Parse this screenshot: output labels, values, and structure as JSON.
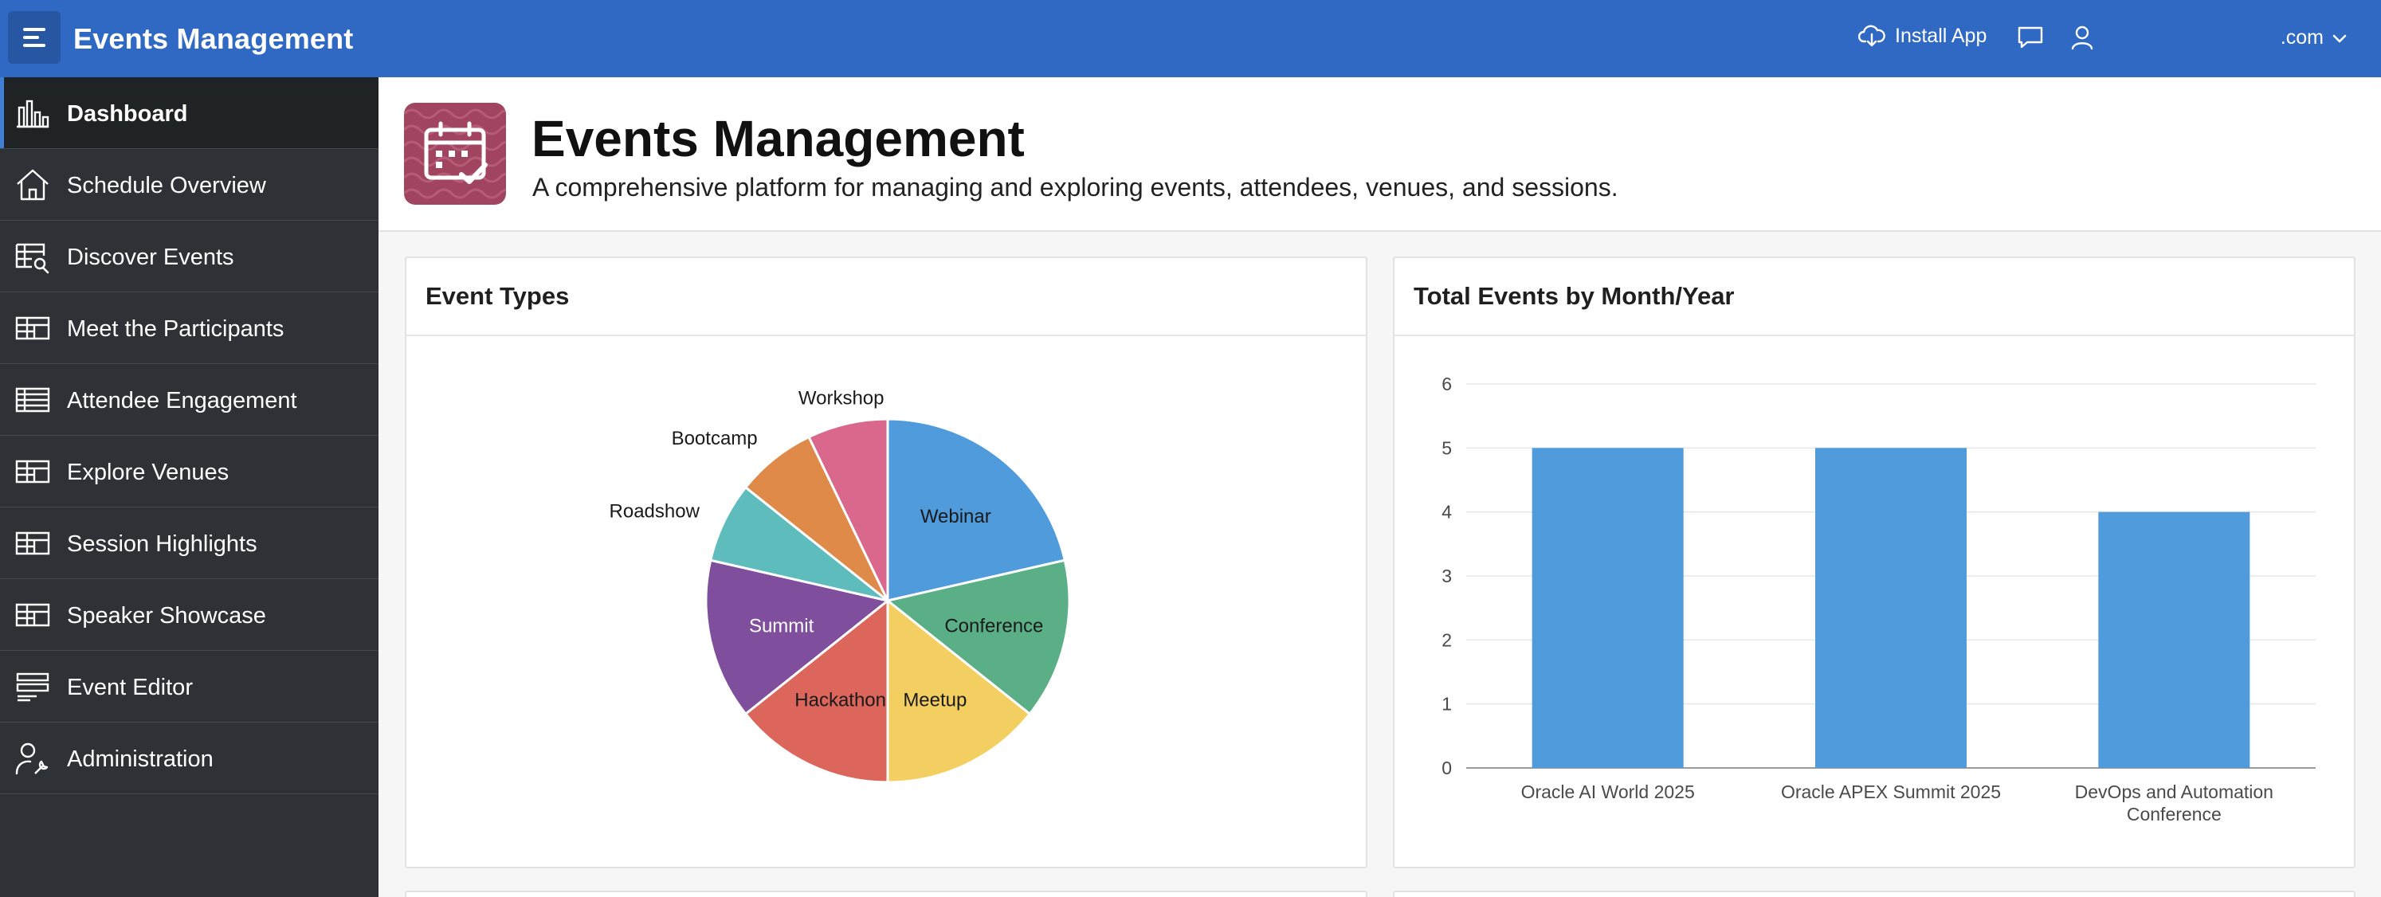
{
  "header": {
    "app_title": "Events Management",
    "install_label": "Install App",
    "user_label": ".com",
    "menu_icon": "hamburger-menu-icon",
    "install_icon": "cloud-download-icon",
    "chat_icon": "chat-bubble-icon",
    "user_icon": "user-icon",
    "color": "#3069c3"
  },
  "sidebar": {
    "items": [
      {
        "label": "Dashboard",
        "icon": "bar-chart-icon",
        "active": true
      },
      {
        "label": "Schedule Overview",
        "icon": "home-icon"
      },
      {
        "label": "Discover Events",
        "icon": "table-search-icon"
      },
      {
        "label": "Meet the Participants",
        "icon": "grid-icon"
      },
      {
        "label": "Attendee Engagement",
        "icon": "table-icon"
      },
      {
        "label": "Explore Venues",
        "icon": "grid-icon"
      },
      {
        "label": "Session Highlights",
        "icon": "grid-icon"
      },
      {
        "label": "Speaker Showcase",
        "icon": "grid-icon"
      },
      {
        "label": "Event Editor",
        "icon": "form-icon"
      },
      {
        "label": "Administration",
        "icon": "user-wrench-icon"
      }
    ]
  },
  "hero": {
    "title": "Events Management",
    "subtitle": "A comprehensive platform for managing and exploring events, attendees, venues, and sessions.",
    "icon": "calendar-check-icon"
  },
  "cards": {
    "pie_title": "Event Types",
    "bar_title": "Total Events by Month/Year"
  },
  "chart_data": [
    {
      "type": "pie",
      "title": "Event Types",
      "labels": [
        "Webinar",
        "Conference",
        "Meetup",
        "Hackathon",
        "Summit",
        "Roadshow",
        "Bootcamp",
        "Workshop"
      ],
      "values": [
        6,
        4,
        4,
        4,
        4,
        2,
        2,
        2
      ],
      "colors": [
        "#4f9bdb",
        "#5aaf86",
        "#f3cf62",
        "#dc665b",
        "#7f4f9e",
        "#5fbcbd",
        "#e08a49",
        "#d9688c"
      ]
    },
    {
      "type": "bar",
      "title": "Total Events by Month/Year",
      "categories": [
        "Oracle AI World 2025",
        "Oracle APEX Summit 2025",
        "DevOps and Automation Conference"
      ],
      "values": [
        5,
        5,
        4
      ],
      "ylim": [
        0,
        6
      ],
      "yticks": [
        0,
        1,
        2,
        3,
        4,
        5,
        6
      ],
      "grid": true,
      "color": "#4f9bdb"
    }
  ]
}
